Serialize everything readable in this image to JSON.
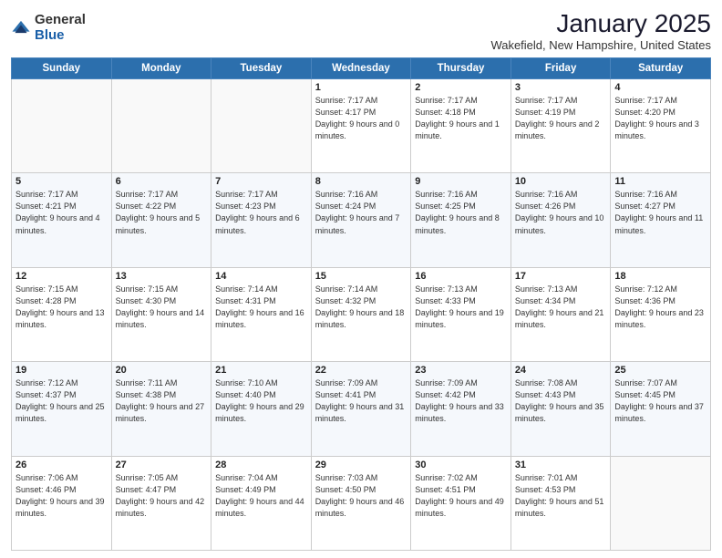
{
  "logo": {
    "general": "General",
    "blue": "Blue"
  },
  "header": {
    "title": "January 2025",
    "location": "Wakefield, New Hampshire, United States"
  },
  "weekdays": [
    "Sunday",
    "Monday",
    "Tuesday",
    "Wednesday",
    "Thursday",
    "Friday",
    "Saturday"
  ],
  "weeks": [
    [
      {
        "day": "",
        "sunrise": "",
        "sunset": "",
        "daylight": ""
      },
      {
        "day": "",
        "sunrise": "",
        "sunset": "",
        "daylight": ""
      },
      {
        "day": "",
        "sunrise": "",
        "sunset": "",
        "daylight": ""
      },
      {
        "day": "1",
        "sunrise": "Sunrise: 7:17 AM",
        "sunset": "Sunset: 4:17 PM",
        "daylight": "Daylight: 9 hours and 0 minutes."
      },
      {
        "day": "2",
        "sunrise": "Sunrise: 7:17 AM",
        "sunset": "Sunset: 4:18 PM",
        "daylight": "Daylight: 9 hours and 1 minute."
      },
      {
        "day": "3",
        "sunrise": "Sunrise: 7:17 AM",
        "sunset": "Sunset: 4:19 PM",
        "daylight": "Daylight: 9 hours and 2 minutes."
      },
      {
        "day": "4",
        "sunrise": "Sunrise: 7:17 AM",
        "sunset": "Sunset: 4:20 PM",
        "daylight": "Daylight: 9 hours and 3 minutes."
      }
    ],
    [
      {
        "day": "5",
        "sunrise": "Sunrise: 7:17 AM",
        "sunset": "Sunset: 4:21 PM",
        "daylight": "Daylight: 9 hours and 4 minutes."
      },
      {
        "day": "6",
        "sunrise": "Sunrise: 7:17 AM",
        "sunset": "Sunset: 4:22 PM",
        "daylight": "Daylight: 9 hours and 5 minutes."
      },
      {
        "day": "7",
        "sunrise": "Sunrise: 7:17 AM",
        "sunset": "Sunset: 4:23 PM",
        "daylight": "Daylight: 9 hours and 6 minutes."
      },
      {
        "day": "8",
        "sunrise": "Sunrise: 7:16 AM",
        "sunset": "Sunset: 4:24 PM",
        "daylight": "Daylight: 9 hours and 7 minutes."
      },
      {
        "day": "9",
        "sunrise": "Sunrise: 7:16 AM",
        "sunset": "Sunset: 4:25 PM",
        "daylight": "Daylight: 9 hours and 8 minutes."
      },
      {
        "day": "10",
        "sunrise": "Sunrise: 7:16 AM",
        "sunset": "Sunset: 4:26 PM",
        "daylight": "Daylight: 9 hours and 10 minutes."
      },
      {
        "day": "11",
        "sunrise": "Sunrise: 7:16 AM",
        "sunset": "Sunset: 4:27 PM",
        "daylight": "Daylight: 9 hours and 11 minutes."
      }
    ],
    [
      {
        "day": "12",
        "sunrise": "Sunrise: 7:15 AM",
        "sunset": "Sunset: 4:28 PM",
        "daylight": "Daylight: 9 hours and 13 minutes."
      },
      {
        "day": "13",
        "sunrise": "Sunrise: 7:15 AM",
        "sunset": "Sunset: 4:30 PM",
        "daylight": "Daylight: 9 hours and 14 minutes."
      },
      {
        "day": "14",
        "sunrise": "Sunrise: 7:14 AM",
        "sunset": "Sunset: 4:31 PM",
        "daylight": "Daylight: 9 hours and 16 minutes."
      },
      {
        "day": "15",
        "sunrise": "Sunrise: 7:14 AM",
        "sunset": "Sunset: 4:32 PM",
        "daylight": "Daylight: 9 hours and 18 minutes."
      },
      {
        "day": "16",
        "sunrise": "Sunrise: 7:13 AM",
        "sunset": "Sunset: 4:33 PM",
        "daylight": "Daylight: 9 hours and 19 minutes."
      },
      {
        "day": "17",
        "sunrise": "Sunrise: 7:13 AM",
        "sunset": "Sunset: 4:34 PM",
        "daylight": "Daylight: 9 hours and 21 minutes."
      },
      {
        "day": "18",
        "sunrise": "Sunrise: 7:12 AM",
        "sunset": "Sunset: 4:36 PM",
        "daylight": "Daylight: 9 hours and 23 minutes."
      }
    ],
    [
      {
        "day": "19",
        "sunrise": "Sunrise: 7:12 AM",
        "sunset": "Sunset: 4:37 PM",
        "daylight": "Daylight: 9 hours and 25 minutes."
      },
      {
        "day": "20",
        "sunrise": "Sunrise: 7:11 AM",
        "sunset": "Sunset: 4:38 PM",
        "daylight": "Daylight: 9 hours and 27 minutes."
      },
      {
        "day": "21",
        "sunrise": "Sunrise: 7:10 AM",
        "sunset": "Sunset: 4:40 PM",
        "daylight": "Daylight: 9 hours and 29 minutes."
      },
      {
        "day": "22",
        "sunrise": "Sunrise: 7:09 AM",
        "sunset": "Sunset: 4:41 PM",
        "daylight": "Daylight: 9 hours and 31 minutes."
      },
      {
        "day": "23",
        "sunrise": "Sunrise: 7:09 AM",
        "sunset": "Sunset: 4:42 PM",
        "daylight": "Daylight: 9 hours and 33 minutes."
      },
      {
        "day": "24",
        "sunrise": "Sunrise: 7:08 AM",
        "sunset": "Sunset: 4:43 PM",
        "daylight": "Daylight: 9 hours and 35 minutes."
      },
      {
        "day": "25",
        "sunrise": "Sunrise: 7:07 AM",
        "sunset": "Sunset: 4:45 PM",
        "daylight": "Daylight: 9 hours and 37 minutes."
      }
    ],
    [
      {
        "day": "26",
        "sunrise": "Sunrise: 7:06 AM",
        "sunset": "Sunset: 4:46 PM",
        "daylight": "Daylight: 9 hours and 39 minutes."
      },
      {
        "day": "27",
        "sunrise": "Sunrise: 7:05 AM",
        "sunset": "Sunset: 4:47 PM",
        "daylight": "Daylight: 9 hours and 42 minutes."
      },
      {
        "day": "28",
        "sunrise": "Sunrise: 7:04 AM",
        "sunset": "Sunset: 4:49 PM",
        "daylight": "Daylight: 9 hours and 44 minutes."
      },
      {
        "day": "29",
        "sunrise": "Sunrise: 7:03 AM",
        "sunset": "Sunset: 4:50 PM",
        "daylight": "Daylight: 9 hours and 46 minutes."
      },
      {
        "day": "30",
        "sunrise": "Sunrise: 7:02 AM",
        "sunset": "Sunset: 4:51 PM",
        "daylight": "Daylight: 9 hours and 49 minutes."
      },
      {
        "day": "31",
        "sunrise": "Sunrise: 7:01 AM",
        "sunset": "Sunset: 4:53 PM",
        "daylight": "Daylight: 9 hours and 51 minutes."
      },
      {
        "day": "",
        "sunrise": "",
        "sunset": "",
        "daylight": ""
      }
    ]
  ]
}
